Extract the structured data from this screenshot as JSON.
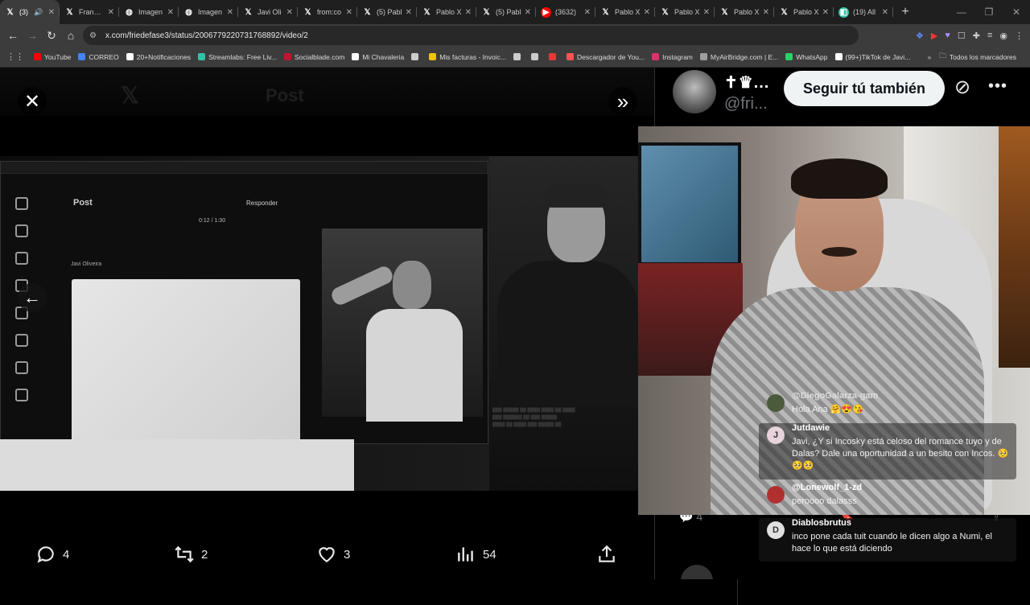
{
  "browser": {
    "tabs": [
      {
        "title": "(3)",
        "icon": "x-icon",
        "active": true
      },
      {
        "title": "Frank C",
        "icon": "x-icon"
      },
      {
        "title": "Imagen",
        "icon": "globe-icon"
      },
      {
        "title": "Imagen",
        "icon": "globe-icon"
      },
      {
        "title": "Javi Oli",
        "icon": "x-icon"
      },
      {
        "title": "from:co",
        "icon": "x-icon"
      },
      {
        "title": "(5) Pabl",
        "icon": "x-icon"
      },
      {
        "title": "Pablo X",
        "icon": "x-icon"
      },
      {
        "title": "(5) Pabl",
        "icon": "x-icon"
      },
      {
        "title": "(3632)",
        "icon": "youtube-icon"
      },
      {
        "title": "Pablo X",
        "icon": "x-icon"
      },
      {
        "title": "Pablo X",
        "icon": "x-icon"
      },
      {
        "title": "Pablo X",
        "icon": "x-icon"
      },
      {
        "title": "Pablo X",
        "icon": "x-icon"
      },
      {
        "title": "(19) All",
        "icon": "streamlabs-icon"
      }
    ],
    "url": "x.com/friedefase3/status/2006779220731768892/video/2",
    "bookmarks": [
      {
        "label": "YouTube",
        "color": "#ff0000"
      },
      {
        "label": "CORREO",
        "color": "#4285f4"
      },
      {
        "label": "20+Notificaciones",
        "color": "#ffffff"
      },
      {
        "label": "Streamlabs: Free Liv...",
        "color": "#31c3a2"
      },
      {
        "label": "Socialblade.com",
        "color": "#c8102e"
      },
      {
        "label": "Mi Chavaleria",
        "color": "#ffffff"
      },
      {
        "label": "",
        "color": "#cccccc"
      },
      {
        "label": "Mis facturas - Invoic...",
        "color": "#f4c20d"
      },
      {
        "label": "",
        "color": "#cccccc"
      },
      {
        "label": "",
        "color": "#cccccc"
      },
      {
        "label": "",
        "color": "#e53935"
      },
      {
        "label": "Descargador de You...",
        "color": "#ff5252"
      },
      {
        "label": "Instagram",
        "color": "#e1306c"
      },
      {
        "label": "MyAirBridge.com | E...",
        "color": "#9e9e9e"
      },
      {
        "label": "WhatsApp",
        "color": "#25d366"
      },
      {
        "label": "(99+)TikTok de Javi...",
        "color": "#ffffff"
      }
    ],
    "all_bookmarks": "Todos los marcadores"
  },
  "video_panel": {
    "inner_post_label": "Post",
    "inner_reply_label": "Responder",
    "inner_time": "0:12 / 1:30",
    "inner_author": "Javi Oliveira"
  },
  "actions": {
    "replies": "4",
    "reposts": "2",
    "likes": "3",
    "views": "54"
  },
  "profile": {
    "name": "✝♛...",
    "handle": "@fri...",
    "follow_label": "Seguir tú también"
  },
  "chat": [
    {
      "user": "@DiegoGalarza-gam",
      "text": "Hola Ana 🤗😍😘",
      "avatar_color": "#4a5a3a"
    },
    {
      "user": "Jutdawie",
      "text": "Javi, ¿Y si Incosky está celoso del romance tuyo y de Dalas? Dale una oportunidad a un besito con Incos. 🥺🥺🥺",
      "avatar_color": "#e7d3dc",
      "avatar_letter": "J"
    },
    {
      "user": "@Lonewolf_1-zd",
      "text": "peroooo dalasss",
      "avatar_color": "#b03030"
    },
    {
      "user": "Diablosbrutus",
      "text": "inco pone cada tuit cuando le dicen algo a Numi, el hace lo que está diciendo",
      "avatar_color": "#e0e0e0",
      "avatar_letter": "D"
    }
  ],
  "right_bottom": {
    "replies": "4"
  }
}
